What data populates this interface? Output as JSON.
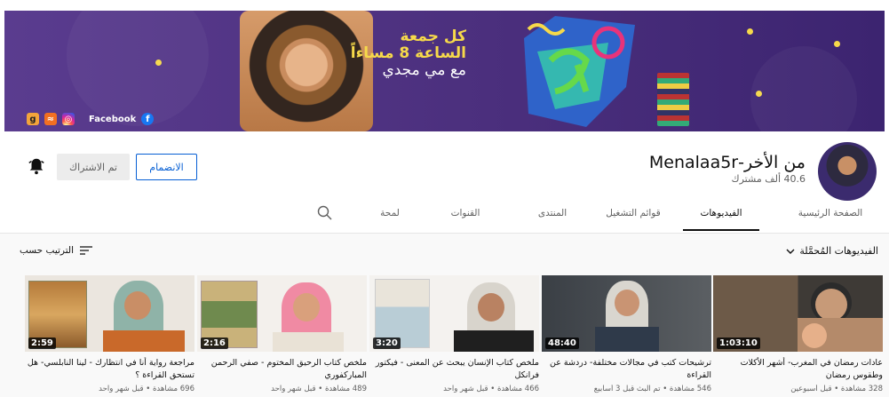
{
  "banner": {
    "line1": "كل جمعة",
    "line2": "الساعة 8 مساءاً",
    "line3": "مع مي مجدي",
    "facebook_label": "Facebook",
    "social_icons": [
      "goodreads-icon",
      "soundcloud-icon",
      "instagram-icon",
      "facebook-icon"
    ],
    "accent": "#f6d94a",
    "bg": "#4b2f7d"
  },
  "channel": {
    "title": "من الأخر-Menalaa5r",
    "subscribers": "40.6 ألف مشترك",
    "join_label": "الانضمام",
    "subscribed_label": "تم الاشتراك"
  },
  "tabs": [
    "الصفحة الرئيسية",
    "الفيديوهات",
    "قوائم التشغيل",
    "المنتدى",
    "القنوات",
    "لمحة"
  ],
  "section": {
    "title": "الفيديوهات المُحمَّلة",
    "sort_label": "الترتيب حسب"
  },
  "videos": [
    {
      "duration": "1:03:10",
      "title": "عادات رمضان في المغرب- أشهر الأكلات وطقوس رمضان",
      "meta": "328 مشاهدة • قبل أسبوعين"
    },
    {
      "duration": "48:40",
      "title": "ترشيحات كتب في مجالات مختلفة- دردشة عن القراءة",
      "meta": "546 مشاهدة • تم البث قبل 3 أسابيع"
    },
    {
      "duration": "3:20",
      "title": "ملخص كتاب الإنسان يبحث عن المعنى - فيكتور فرانكل",
      "meta": "466 مشاهدة • قبل شهر واحد"
    },
    {
      "duration": "2:16",
      "title": "ملخص كتاب الرحيق المختوم - صفي الرحمن المباركفوري",
      "meta": "489 مشاهدة • قبل شهر واحد"
    },
    {
      "duration": "2:59",
      "title": "مراجعة رواية أنا في انتظارك - لينا النابلسي- هل تستحق القراءة ؟",
      "meta": "696 مشاهدة • قبل شهر واحد"
    }
  ]
}
